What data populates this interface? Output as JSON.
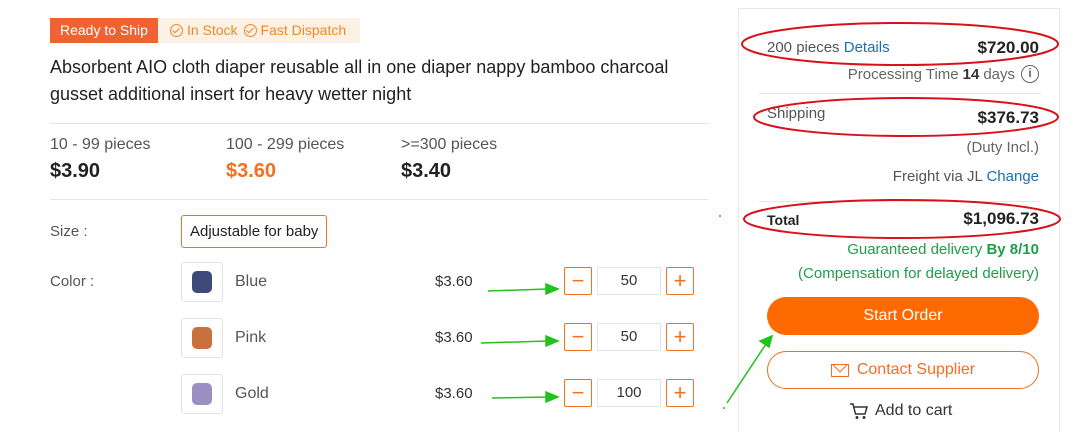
{
  "badges": {
    "ready": "Ready to Ship",
    "in_stock": "In Stock",
    "fast_dispatch": "Fast Dispatch"
  },
  "product": {
    "title": "Absorbent AIO cloth diaper reusable all in one diaper nappy bamboo charcoal gusset additional insert for heavy wetter night"
  },
  "tiers": [
    {
      "range": "10 - 99 pieces",
      "price": "$3.90"
    },
    {
      "range": "100 - 299 pieces",
      "price": "$3.60"
    },
    {
      "range": ">=300 pieces",
      "price": "$3.40"
    }
  ],
  "size": {
    "label": "Size :",
    "option": "Adjustable for baby"
  },
  "color": {
    "label": "Color :",
    "options": [
      {
        "name": "Blue",
        "price": "$3.60",
        "qty": "50",
        "swatch": "#3d4a7a"
      },
      {
        "name": "Pink",
        "price": "$3.60",
        "qty": "50",
        "swatch": "#c8713a"
      },
      {
        "name": "Gold",
        "price": "$3.60",
        "qty": "100",
        "swatch": "#9b8fc4"
      }
    ]
  },
  "summary": {
    "pieces": "200 pieces",
    "details_link": "Details",
    "subtotal": "$720.00",
    "processing_label": "Processing Time",
    "processing_days": "14",
    "processing_unit": "days",
    "shipping_label": "Shipping",
    "shipping_amount": "$376.73",
    "duty": "(Duty Incl.)",
    "freight": "Freight via JL",
    "change_link": "Change",
    "total_label": "Total",
    "total_amount": "$1,096.73",
    "guaranteed": "Guaranteed delivery",
    "guaranteed_date": "By 8/10",
    "compensation": "(Compensation for delayed delivery)",
    "start_order": "Start Order",
    "contact_supplier": "Contact Supplier",
    "add_to_cart": "Add to cart"
  },
  "colors": {
    "accent": "#f36f21",
    "brand_button": "#ff6a00",
    "badge_red": "#f06233",
    "green": "#1e9e4a",
    "link": "#1a6fb5",
    "annotation_red": "#d8111b",
    "annotation_green": "#22c21e"
  }
}
